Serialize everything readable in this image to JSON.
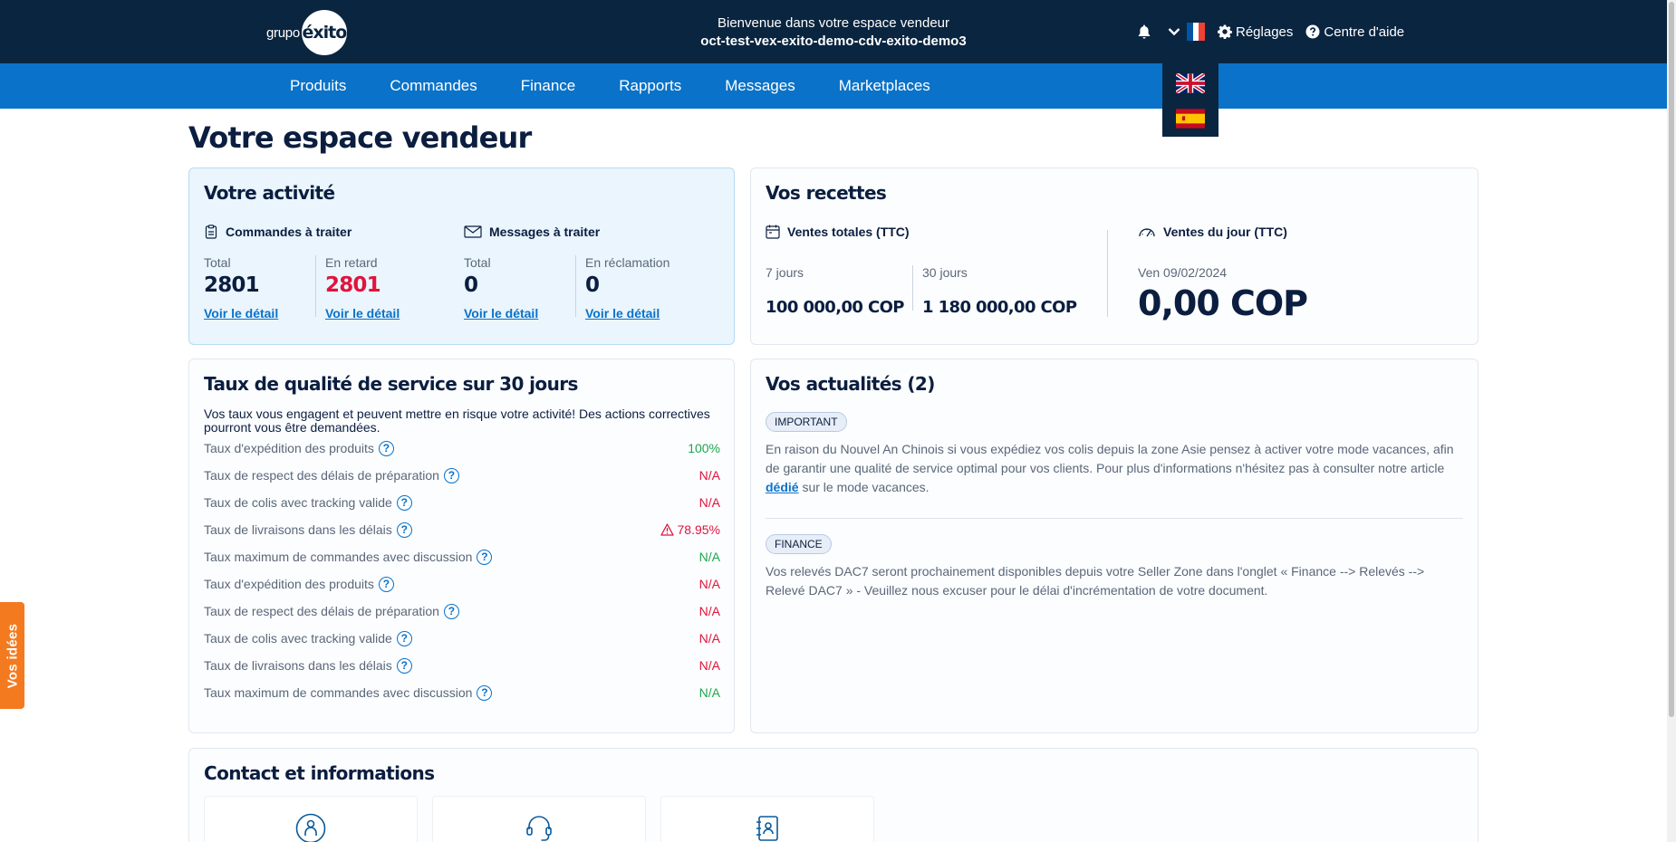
{
  "header": {
    "logo_small": "grupo",
    "logo_main": "éxito",
    "welcome": "Bienvenue dans votre espace vendeur",
    "shop_name": "oct-test-vex-exito-demo-cdv-exito-demo3",
    "settings_label": "Réglages",
    "help_label": "Centre d'aide"
  },
  "nav": {
    "items": [
      "Produits",
      "Commandes",
      "Finance",
      "Rapports",
      "Messages",
      "Marketplaces"
    ]
  },
  "page_title": "Votre espace vendeur",
  "activity": {
    "title": "Votre activité",
    "orders_title": "Commandes à traiter",
    "messages_title": "Messages à traiter",
    "stats": [
      {
        "label": "Total",
        "value": "2801",
        "link": "Voir le détail"
      },
      {
        "label": "En retard",
        "value": "2801",
        "link": "Voir le détail"
      },
      {
        "label": "Total",
        "value": "0",
        "link": "Voir le détail"
      },
      {
        "label": "En réclamation",
        "value": "0",
        "link": "Voir le détail"
      }
    ]
  },
  "recettes": {
    "title": "Vos recettes",
    "total_title": "Ventes totales (TTC)",
    "day_title": "Ventes du jour (TTC)",
    "period1_label": "7 jours",
    "period1_value": "100 000,00 COP",
    "period2_label": "30 jours",
    "period2_value": "1 180 000,00 COP",
    "day_date": "Ven 09/02/2024",
    "day_value": "0,00 COP"
  },
  "quality": {
    "title": "Taux de qualité de service sur 30 jours",
    "description": "Vos taux vous engagent et peuvent mettre en risque votre activité! Des actions correctives pourront vous être demandées.",
    "help_glyph": "?",
    "rows": [
      {
        "name": "Taux d'expédition des produits",
        "value": "100%",
        "status": "green"
      },
      {
        "name": "Taux de respect des délais de préparation",
        "value": "N/A",
        "status": "red"
      },
      {
        "name": "Taux de colis avec tracking valide",
        "value": "N/A",
        "status": "red"
      },
      {
        "name": "Taux de livraisons dans les délais",
        "value": "78.95%",
        "status": "red",
        "warning": true
      },
      {
        "name": "Taux maximum de commandes avec discussion",
        "value": "N/A",
        "status": "green"
      },
      {
        "name": "Taux d'expédition des produits",
        "value": "N/A",
        "status": "red"
      },
      {
        "name": "Taux de respect des délais de préparation",
        "value": "N/A",
        "status": "red"
      },
      {
        "name": "Taux de colis avec tracking valide",
        "value": "N/A",
        "status": "red"
      },
      {
        "name": "Taux de livraisons dans les délais",
        "value": "N/A",
        "status": "red"
      },
      {
        "name": "Taux maximum de commandes avec discussion",
        "value": "N/A",
        "status": "green"
      }
    ]
  },
  "news": {
    "title": "Vos actualités (2)",
    "items": [
      {
        "badge": "IMPORTANT",
        "text_before": "En raison du Nouvel An Chinois si vous expédiez vos colis depuis la zone Asie pensez à activer votre mode vacances, afin de garantir une qualité de service optimal pour vos clients. Pour plus d'informations n'hésitez pas à consulter notre article ",
        "link": "dédié",
        "text_after": " sur le mode vacances."
      },
      {
        "badge": "FINANCE",
        "text": "Vos relevés DAC7 seront prochainement disponibles depuis votre Seller Zone dans l'onglet « Finance --> Relevés --> Relevé DAC7 » - Veuillez nous excuser pour le délai d'incrémentation de votre document."
      }
    ]
  },
  "contact": {
    "title": "Contact et informations"
  },
  "ideas_tab": "Vos idées",
  "colors": {
    "header_bg": "#0a2540",
    "nav_bg": "#0a72c8",
    "accent_red": "#e0143c",
    "accent_green": "#1ea64c",
    "ideas_orange": "#f47a1f"
  }
}
